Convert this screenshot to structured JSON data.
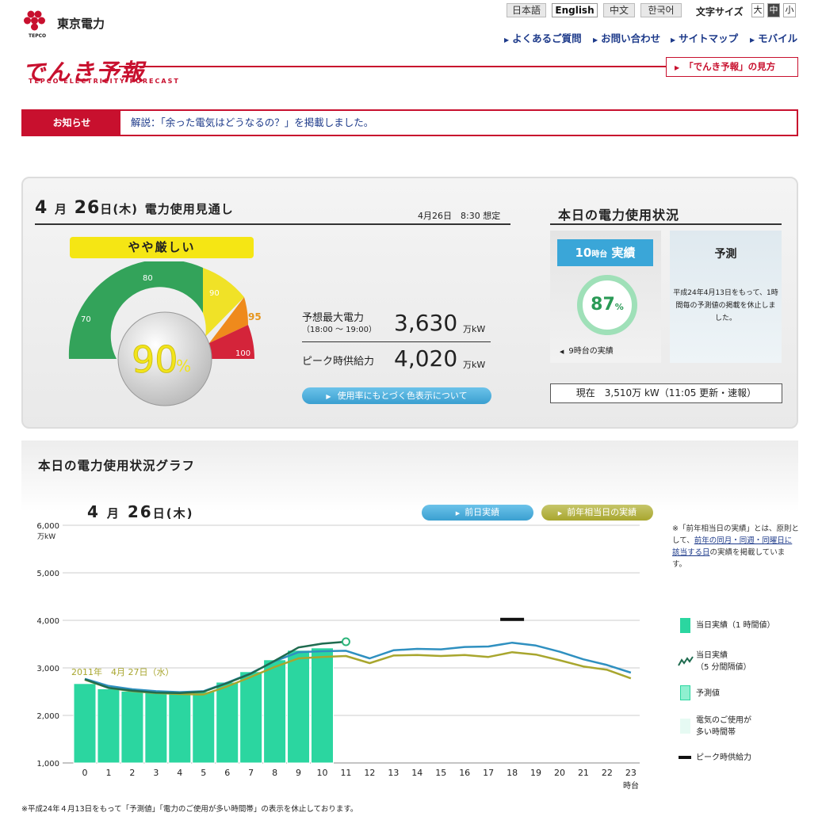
{
  "header": {
    "company": "東京電力",
    "company_en": "TEPCO",
    "languages": [
      "日本語",
      "English",
      "中文",
      "한국어"
    ],
    "selected_language": "English",
    "font_size_label": "文字サイズ",
    "font_sizes": [
      "大",
      "中",
      "小"
    ],
    "active_font_size": "中",
    "nav": [
      "よくあるご質問",
      "お問い合わせ",
      "サイトマップ",
      "モバイル"
    ],
    "brand": "でんき予報",
    "brand_sub": "TEPCO ELECTRICITY FORECAST",
    "howto_link": "「でんき予報」の見方",
    "colors": {
      "brand_red": "#c8102e",
      "link_blue": "#1d3a8a"
    }
  },
  "notice": {
    "label": "お知らせ",
    "text": "解説：「余った電気はどうなるの？」を掲載しました。"
  },
  "outlook": {
    "title_month": "4",
    "title_month_unit": "月",
    "title_day": "26",
    "title_day_unit": "日",
    "title_dow": "(木)",
    "title_suffix": "電力使用見通し",
    "assumed": "4月26日　8:30 想定",
    "level": "やや厳しい",
    "gauge": {
      "value_pct": "90",
      "pct_sign": "%",
      "ticks": [
        "70",
        "80",
        "90",
        "95",
        "100"
      ]
    },
    "peak_demand_label": "予想最大電力",
    "peak_demand_time": "（18:00 ～ 19:00）",
    "peak_demand_value": "3,630",
    "peak_demand_unit": "万kW",
    "supply_label": "ピーク時供給力",
    "supply_value": "4,020",
    "supply_unit": "万kW",
    "color_button": "使用率にもとづく色表示について"
  },
  "today": {
    "title": "本日の電力使用状況",
    "hour": "10",
    "hour_unit": "時台",
    "actual_label": "実績",
    "usage": "87",
    "usage_pct": "%",
    "prev_hour_link": "9時台の実績",
    "forecast_title": "予測",
    "forecast_text": "平成24年4月13日をもって、1時間毎の予測値の掲載を休止しました。",
    "current": "現在　3,510万 kW（11:05 更新・速報）"
  },
  "graph": {
    "title": "本日の電力使用状況グラフ",
    "date_month": "4",
    "date_day": "26",
    "date_m_unit": "月",
    "date_d_unit": "日",
    "date_dow": "(木)",
    "btn_prev_day": "前日実績",
    "btn_prev_year": "前年相当日の実績",
    "note_head": "※「前年相当日の実績」とは、原則として、",
    "note_link": "前年の同月・同週・同曜日に該当する日",
    "note_tail": "の実績を掲載しています。",
    "legend": [
      "当日実績（1 時間値）",
      "当日実績",
      "（5 分間隔値）",
      "予測値",
      "電気のご使用が",
      "多い時間帯",
      "ピーク時供給力"
    ],
    "footnote": "※平成24年４月13日をもって「予測値」「電力のご使用が多い時間帯」の表示を休止しております。"
  },
  "chart_data": {
    "type": "bar",
    "ylabel": "万kW",
    "xlabel": "時台",
    "ylim": [
      1000,
      6000
    ],
    "y_ticks": [
      "1,000",
      "2,000",
      "3,000",
      "4,000",
      "5,000",
      "6,000"
    ],
    "categories": [
      "0",
      "1",
      "2",
      "3",
      "4",
      "5",
      "6",
      "7",
      "8",
      "9",
      "10",
      "11",
      "12",
      "13",
      "14",
      "15",
      "16",
      "17",
      "18",
      "19",
      "20",
      "21",
      "22",
      "23"
    ],
    "series": [
      {
        "name": "当日実績（1 時間値）",
        "type": "bar",
        "values": [
          2670,
          2560,
          2510,
          2480,
          2480,
          2500,
          2700,
          2920,
          3170,
          3370,
          3420
        ]
      },
      {
        "name": "当日実績（5 分間隔値）",
        "type": "line",
        "values": [
          2760,
          2580,
          2520,
          2480,
          2470,
          2500,
          2680,
          2880,
          3150,
          3430,
          3510,
          3550
        ]
      },
      {
        "name": "前日実績",
        "type": "line",
        "values": [
          2770,
          2620,
          2550,
          2510,
          2490,
          2510,
          2690,
          2890,
          3140,
          3330,
          3350,
          3360,
          3200,
          3370,
          3400,
          3390,
          3440,
          3450,
          3530,
          3470,
          3340,
          3180,
          3060,
          2900
        ]
      },
      {
        "name": "前年相当日の実績",
        "type": "line",
        "label": "2011年　4月 27日（水）",
        "values": [
          2750,
          2580,
          2510,
          2470,
          2450,
          2440,
          2610,
          2810,
          3020,
          3200,
          3230,
          3250,
          3100,
          3260,
          3270,
          3250,
          3270,
          3230,
          3330,
          3280,
          3160,
          3030,
          2960,
          2780
        ]
      }
    ],
    "peak_supply": {
      "x": "18",
      "value": 4020
    },
    "colors": {
      "actual": "#2bd6a0",
      "actual_5min": "#1f6b4f",
      "prev_day": "#2f90c0",
      "prev_year": "#a8a62e"
    }
  }
}
